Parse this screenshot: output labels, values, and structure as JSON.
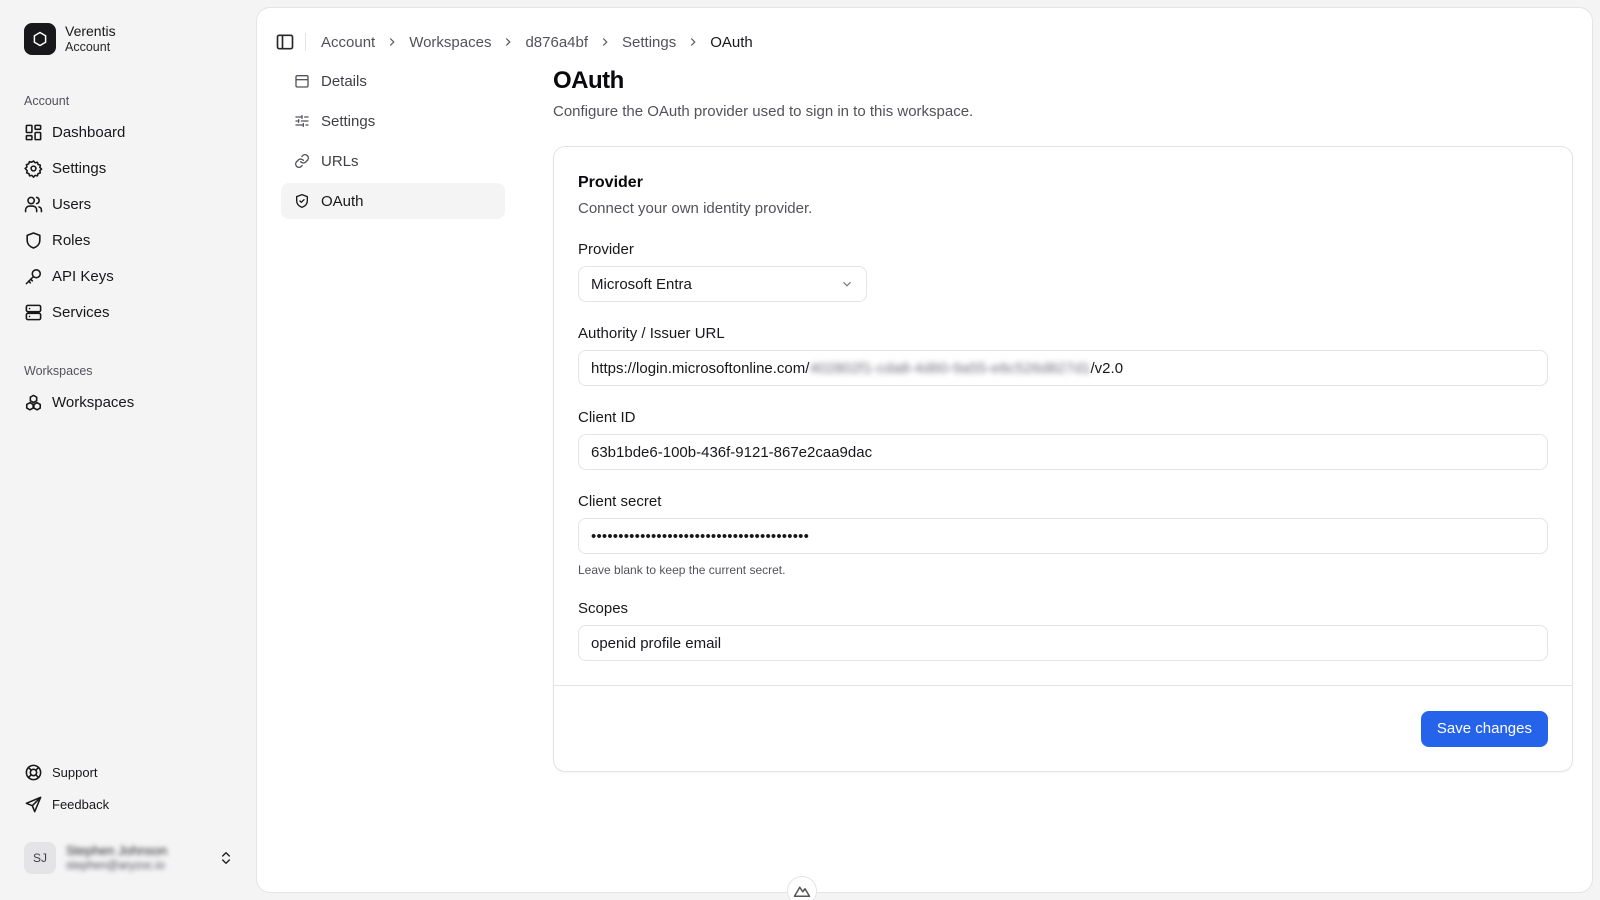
{
  "brand": {
    "name": "Verentis",
    "subtitle": "Account"
  },
  "sidebar": {
    "account_label": "Account",
    "account_items": [
      {
        "label": "Dashboard",
        "icon": "dashboard-icon"
      },
      {
        "label": "Settings",
        "icon": "gear-icon"
      },
      {
        "label": "Users",
        "icon": "users-icon"
      },
      {
        "label": "Roles",
        "icon": "shield-icon"
      },
      {
        "label": "API Keys",
        "icon": "key-icon"
      },
      {
        "label": "Services",
        "icon": "server-icon"
      }
    ],
    "workspaces_label": "Workspaces",
    "workspace_items": [
      {
        "label": "Workspaces",
        "icon": "workspaces-icon"
      }
    ],
    "support": "Support",
    "feedback": "Feedback",
    "user": {
      "initials": "SJ",
      "name": "Stephen Johnson",
      "email": "stephen@aryzoc.io"
    }
  },
  "breadcrumb": [
    "Account",
    "Workspaces",
    "d876a4bf",
    "Settings",
    "OAuth"
  ],
  "subnav": [
    {
      "label": "Details",
      "icon": "calendar-icon",
      "active": false
    },
    {
      "label": "Settings",
      "icon": "sliders-icon",
      "active": false
    },
    {
      "label": "URLs",
      "icon": "link-icon",
      "active": false
    },
    {
      "label": "OAuth",
      "icon": "shield-check-icon",
      "active": true
    }
  ],
  "page": {
    "title": "OAuth",
    "description": "Configure the OAuth provider used to sign in to this workspace."
  },
  "card": {
    "title": "Provider",
    "description": "Connect your own identity provider.",
    "provider_label": "Provider",
    "provider_value": "Microsoft Entra",
    "authority_label": "Authority / Issuer URL",
    "authority_prefix": "https://login.microsoftonline.com/",
    "authority_tenant": "402802f1-cda8-4d60-9a55-e6c526d827d1",
    "authority_suffix": "/v2.0",
    "client_id_label": "Client ID",
    "client_id_value": "63b1bde6-100b-436f-9121-867e2caa9dac",
    "client_secret_label": "Client secret",
    "client_secret_value": "••••••••••••••••••••••••••••••••••••••••",
    "client_secret_hint": "Leave blank to keep the current secret.",
    "scopes_label": "Scopes",
    "scopes_value": "openid profile email",
    "save_label": "Save changes"
  },
  "colors": {
    "accent": "#2563eb",
    "background": "#f4f4f5",
    "text": "#18181b"
  }
}
